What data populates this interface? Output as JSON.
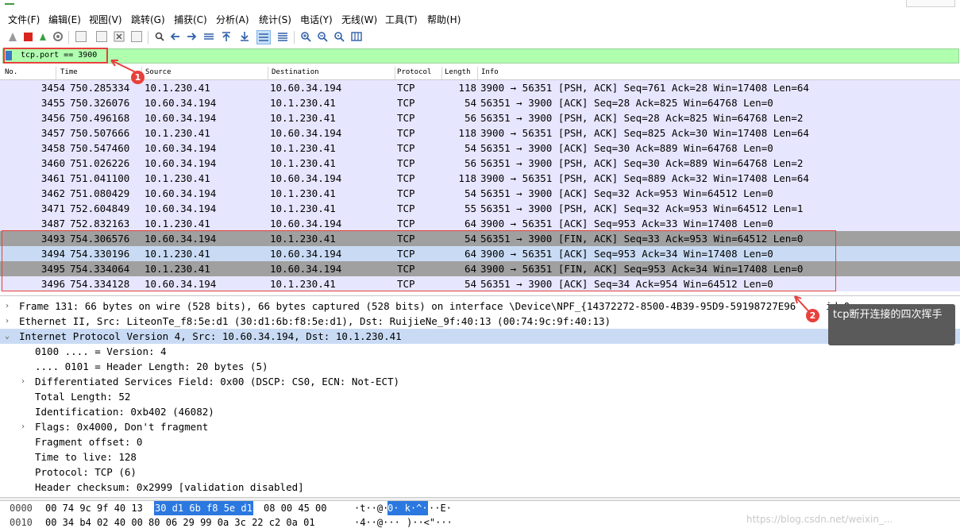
{
  "menu": [
    "文件(F)",
    "编辑(E)",
    "视图(V)",
    "跳转(G)",
    "捕获(C)",
    "分析(A)",
    "统计(S)",
    "电话(Y)",
    "无线(W)",
    "工具(T)",
    "帮助(H)"
  ],
  "toolbar_icons": [
    "shark-fin-start-icon",
    "stop-icon",
    "restart-icon",
    "options-icon",
    "open-file-icon",
    "save-file-icon",
    "close-file-icon",
    "reload-icon",
    "find-icon",
    "back-icon",
    "forward-icon",
    "goto-packet-icon",
    "first-packet-icon",
    "last-packet-icon",
    "autoscroll-icon",
    "colorize-icon",
    "zoom-in-icon",
    "zoom-out-icon",
    "zoom-reset-icon",
    "resize-columns-icon"
  ],
  "filter": {
    "value": "tcp.port == 3900"
  },
  "columns": {
    "no": "No.",
    "time": "Time",
    "source": "Source",
    "destination": "Destination",
    "protocol": "Protocol",
    "length": "Length",
    "info": "Info"
  },
  "packets": [
    {
      "no": "3454",
      "time": "750.285334",
      "src": "10.1.230.41",
      "dst": "10.60.34.194",
      "proto": "TCP",
      "len": "118",
      "info": "3900 → 56351 [PSH, ACK] Seq=761 Ack=28 Win=17408 Len=64",
      "style": "normal"
    },
    {
      "no": "3455",
      "time": "750.326076",
      "src": "10.60.34.194",
      "dst": "10.1.230.41",
      "proto": "TCP",
      "len": "54",
      "info": "56351 → 3900 [ACK] Seq=28 Ack=825 Win=64768 Len=0",
      "style": "normal"
    },
    {
      "no": "3456",
      "time": "750.496168",
      "src": "10.60.34.194",
      "dst": "10.1.230.41",
      "proto": "TCP",
      "len": "56",
      "info": "56351 → 3900 [PSH, ACK] Seq=28 Ack=825 Win=64768 Len=2",
      "style": "normal"
    },
    {
      "no": "3457",
      "time": "750.507666",
      "src": "10.1.230.41",
      "dst": "10.60.34.194",
      "proto": "TCP",
      "len": "118",
      "info": "3900 → 56351 [PSH, ACK] Seq=825 Ack=30 Win=17408 Len=64",
      "style": "normal"
    },
    {
      "no": "3458",
      "time": "750.547460",
      "src": "10.60.34.194",
      "dst": "10.1.230.41",
      "proto": "TCP",
      "len": "54",
      "info": "56351 → 3900 [ACK] Seq=30 Ack=889 Win=64768 Len=0",
      "style": "normal"
    },
    {
      "no": "3460",
      "time": "751.026226",
      "src": "10.60.34.194",
      "dst": "10.1.230.41",
      "proto": "TCP",
      "len": "56",
      "info": "56351 → 3900 [PSH, ACK] Seq=30 Ack=889 Win=64768 Len=2",
      "style": "normal"
    },
    {
      "no": "3461",
      "time": "751.041100",
      "src": "10.1.230.41",
      "dst": "10.60.34.194",
      "proto": "TCP",
      "len": "118",
      "info": "3900 → 56351 [PSH, ACK] Seq=889 Ack=32 Win=17408 Len=64",
      "style": "normal"
    },
    {
      "no": "3462",
      "time": "751.080429",
      "src": "10.60.34.194",
      "dst": "10.1.230.41",
      "proto": "TCP",
      "len": "54",
      "info": "56351 → 3900 [ACK] Seq=32 Ack=953 Win=64512 Len=0",
      "style": "normal"
    },
    {
      "no": "3471",
      "time": "752.604849",
      "src": "10.60.34.194",
      "dst": "10.1.230.41",
      "proto": "TCP",
      "len": "55",
      "info": "56351 → 3900 [PSH, ACK] Seq=32 Ack=953 Win=64512 Len=1",
      "style": "normal"
    },
    {
      "no": "3487",
      "time": "752.832163",
      "src": "10.1.230.41",
      "dst": "10.60.34.194",
      "proto": "TCP",
      "len": "64",
      "info": "3900 → 56351 [ACK] Seq=953 Ack=33 Win=17408 Len=0",
      "style": "normal"
    },
    {
      "no": "3493",
      "time": "754.306576",
      "src": "10.60.34.194",
      "dst": "10.1.230.41",
      "proto": "TCP",
      "len": "54",
      "info": "56351 → 3900 [FIN, ACK] Seq=33 Ack=953 Win=64512 Len=0",
      "style": "fin"
    },
    {
      "no": "3494",
      "time": "754.330196",
      "src": "10.1.230.41",
      "dst": "10.60.34.194",
      "proto": "TCP",
      "len": "64",
      "info": "3900 → 56351 [ACK] Seq=953 Ack=34 Win=17408 Len=0",
      "style": "selected"
    },
    {
      "no": "3495",
      "time": "754.334064",
      "src": "10.1.230.41",
      "dst": "10.60.34.194",
      "proto": "TCP",
      "len": "64",
      "info": "3900 → 56351 [FIN, ACK] Seq=953 Ack=34 Win=17408 Len=0",
      "style": "fin"
    },
    {
      "no": "3496",
      "time": "754.334128",
      "src": "10.60.34.194",
      "dst": "10.1.230.41",
      "proto": "TCP",
      "len": "54",
      "info": "56351 → 3900 [ACK] Seq=34 Ack=954 Win=64512 Len=0",
      "style": "normal"
    }
  ],
  "details": [
    {
      "arrow": "›",
      "text": "Frame 131: 66 bytes on wire (528 bits), 66 bytes captured (528 bits) on interface \\Device\\NPF_{14372272-8500-4B39-95D9-59198727E96",
      "indent": 0,
      "selected": false
    },
    {
      "arrow": "›",
      "text": "Ethernet II, Src: LiteonTe_f8:5e:d1 (30:d1:6b:f8:5e:d1), Dst: RuijieNe_9f:40:13 (00:74:9c:9f:40:13)",
      "indent": 0,
      "selected": false
    },
    {
      "arrow": "⌄",
      "text": "Internet Protocol Version 4, Src: 10.60.34.194, Dst: 10.1.230.41",
      "indent": 0,
      "selected": true
    },
    {
      "arrow": "",
      "text": "0100 .... = Version: 4",
      "indent": 1,
      "selected": false
    },
    {
      "arrow": "",
      "text": ".... 0101 = Header Length: 20 bytes (5)",
      "indent": 1,
      "selected": false
    },
    {
      "arrow": "›",
      "text": "Differentiated Services Field: 0x00 (DSCP: CS0, ECN: Not-ECT)",
      "indent": 1,
      "selected": false
    },
    {
      "arrow": "",
      "text": "Total Length: 52",
      "indent": 1,
      "selected": false
    },
    {
      "arrow": "",
      "text": "Identification: 0xb402 (46082)",
      "indent": 1,
      "selected": false
    },
    {
      "arrow": "›",
      "text": "Flags: 0x4000, Don't fragment",
      "indent": 1,
      "selected": false
    },
    {
      "arrow": "",
      "text": "Fragment offset: 0",
      "indent": 1,
      "selected": false
    },
    {
      "arrow": "",
      "text": "Time to live: 128",
      "indent": 1,
      "selected": false
    },
    {
      "arrow": "",
      "text": "Protocol: TCP (6)",
      "indent": 1,
      "selected": false
    },
    {
      "arrow": "",
      "text": "Header checksum: 0x2999 [validation disabled]",
      "indent": 1,
      "selected": false
    }
  ],
  "bytes": [
    {
      "offset": "0000",
      "pre": "00 74 9c 9f 40 13",
      "highlight": "30 d1  6b f8 5e d1",
      "post": "08 00 45 00",
      "ascii1": "·t··@·",
      "ascii2": "0· k·^·",
      "ascii3": "··E·"
    },
    {
      "offset": "0010",
      "pre": "00 34 b4 02 40 00 80 06  29 99 0a 3c 22 c2 0a 01",
      "highlight": "",
      "post": "",
      "ascii1": "·4··@···",
      "ascii2": "",
      "ascii3": ")··<\"···"
    }
  ],
  "annotations": {
    "badge1": "1",
    "badge2": "2",
    "tooltip": "tcp断开连接的四次挥手",
    "trailing_text": "id 0"
  },
  "watermark": "https://blog.csdn.net/weixin_...",
  "colors": {
    "filter_bg": "#afffaf",
    "row_normal": "#e7e6ff",
    "row_fin": "#a0a0a0",
    "row_selected": "#c9dbf4",
    "annotation_red": "#e8403c",
    "byte_highlight": "#2b78e0"
  }
}
